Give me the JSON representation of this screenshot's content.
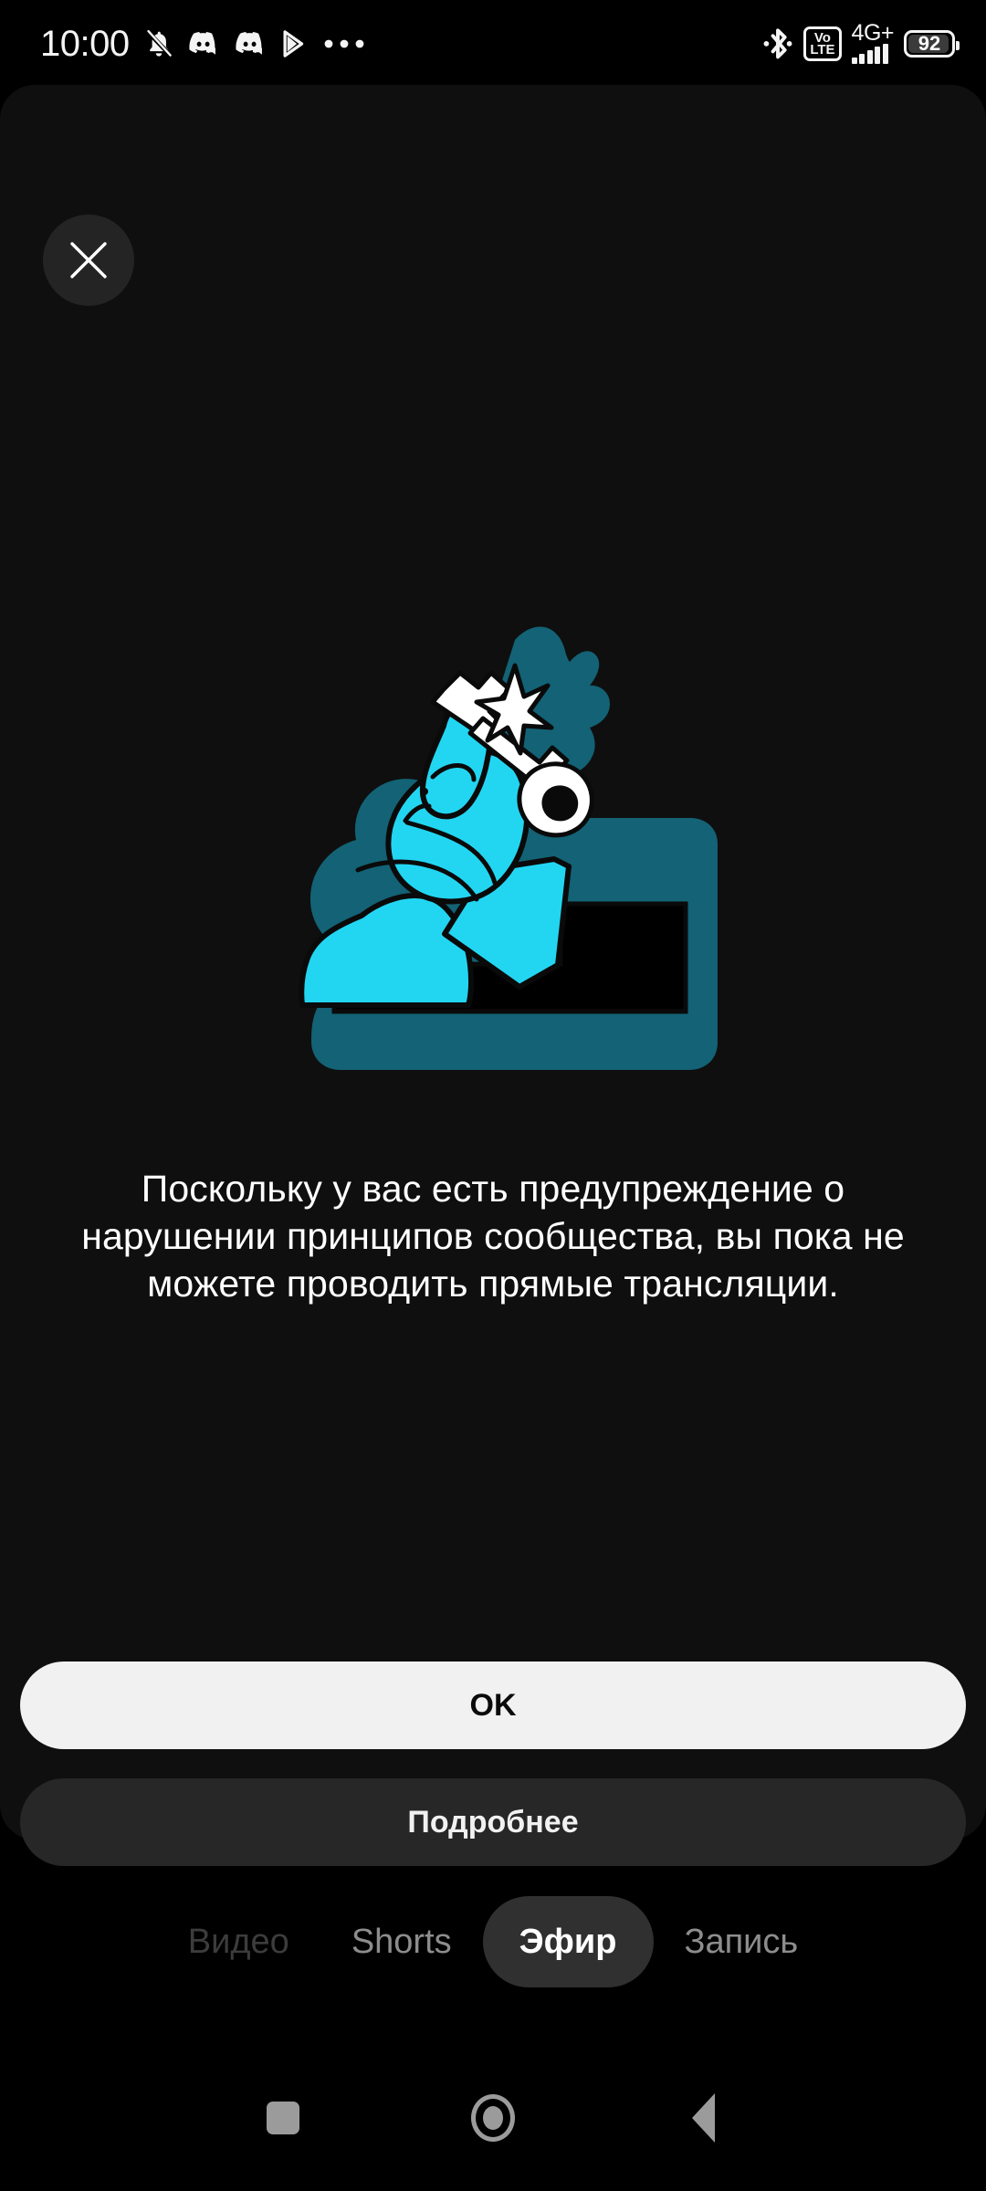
{
  "status_bar": {
    "time": "10:00",
    "left_icons": [
      {
        "name": "notifications-off-icon"
      },
      {
        "name": "discord-icon"
      },
      {
        "name": "discord-icon"
      },
      {
        "name": "play-triangle-icon"
      },
      {
        "name": "more-dots-icon"
      }
    ],
    "bluetooth_icon": "bluetooth-icon",
    "volte_top": "Vo",
    "volte_bottom": "LTE",
    "network": "4G+",
    "signal_bars": 5,
    "battery_level": "92"
  },
  "sheet": {
    "close_label": "×",
    "illustration": {
      "name": "person-with-key-illustration",
      "colors": {
        "cyan": "#22D6F2",
        "teal": "#136275",
        "outline": "#0a0a0a",
        "white": "#ffffff",
        "dark": "#000000"
      }
    },
    "message": "Поскольку у вас есть предупреждение о нарушении принципов сообщества, вы пока не можете проводить прямые трансляции.",
    "primary_button": "OK",
    "secondary_button": "Подробнее"
  },
  "tabs": [
    {
      "label": "Видео",
      "state": "disabled"
    },
    {
      "label": "Shorts",
      "state": "normal"
    },
    {
      "label": "Эфир",
      "state": "active"
    },
    {
      "label": "Запись",
      "state": "normal"
    }
  ],
  "nav_bar": {
    "recents": "recents-square-icon",
    "home": "home-circle-icon",
    "back": "back-triangle-icon"
  },
  "colors": {
    "background": "#000000",
    "sheet": "#0f0f0f",
    "primary_button": "#f1f1f1",
    "secondary_button": "#272727",
    "accent_cyan": "#22D6F2",
    "accent_teal": "#136275",
    "tab_active_pill": "#303030"
  }
}
